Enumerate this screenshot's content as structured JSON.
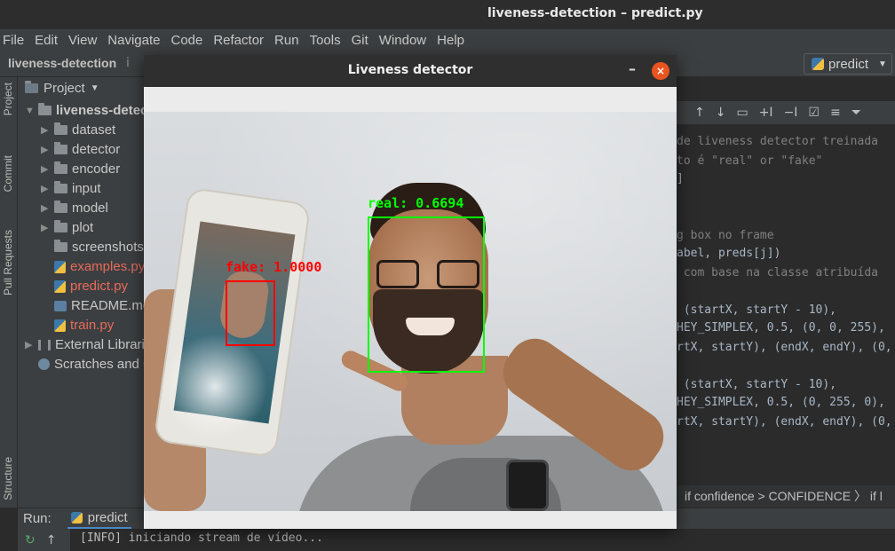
{
  "window": {
    "title": "liveness-detection – predict.py"
  },
  "menu": [
    "File",
    "Edit",
    "View",
    "Navigate",
    "Code",
    "Refactor",
    "Run",
    "Tools",
    "Git",
    "Window",
    "Help"
  ],
  "navbar": {
    "project": "liveness-detection",
    "next_crumb": "i",
    "run_config": "predict"
  },
  "left_tabs": {
    "project": "Project",
    "commit": "Commit",
    "pull_requests": "Pull Requests",
    "structure": "Structure"
  },
  "project_panel": {
    "header": "Project",
    "items": [
      {
        "label": "liveness-detection",
        "type": "root"
      },
      {
        "label": "dataset",
        "type": "folder"
      },
      {
        "label": "detector",
        "type": "folder"
      },
      {
        "label": "encoder",
        "type": "folder"
      },
      {
        "label": "input",
        "type": "folder"
      },
      {
        "label": "model",
        "type": "folder"
      },
      {
        "label": "plot",
        "type": "folder"
      },
      {
        "label": "screenshots",
        "type": "folder"
      },
      {
        "label": "examples.py",
        "type": "py",
        "modified": true
      },
      {
        "label": "predict.py",
        "type": "py",
        "modified": true
      },
      {
        "label": "README.md",
        "type": "md"
      },
      {
        "label": "train.py",
        "type": "py",
        "modified": true
      },
      {
        "label": "External Libraries",
        "type": "lib"
      },
      {
        "label": "Scratches and Consoles",
        "type": "scratch"
      }
    ]
  },
  "editor": {
    "lines": [
      "de liveness detector treinada",
      "to é \"real\" or \"fake\"",
      "]",
      "g box no frame",
      "abel, preds[j])",
      " com base na classe atribuída",
      " (startX, startY - 10),",
      "HEY_SIMPLEX, 0.5, (0, 0, 255),",
      "rtX, startY), (endX, endY), (0,",
      " (startX, startY - 10),",
      "HEY_SIMPLEX, 0.5, (0, 255, 0),",
      "rtX, startY), (endX, endY), (0,"
    ],
    "breadcrumb": "if confidence > CONFIDENCE  〉 if l"
  },
  "dialog": {
    "title": "Liveness detector",
    "minimize": "–",
    "close": "×"
  },
  "detections": [
    {
      "label": "fake: 1.0000",
      "color": "#ff0000"
    },
    {
      "label": "real: 0.6694",
      "color": "#00ff00"
    }
  ],
  "run_panel": {
    "label": "Run:",
    "tab": "predict",
    "console_line": "[INFO] iniciando stream de vídeo..."
  }
}
